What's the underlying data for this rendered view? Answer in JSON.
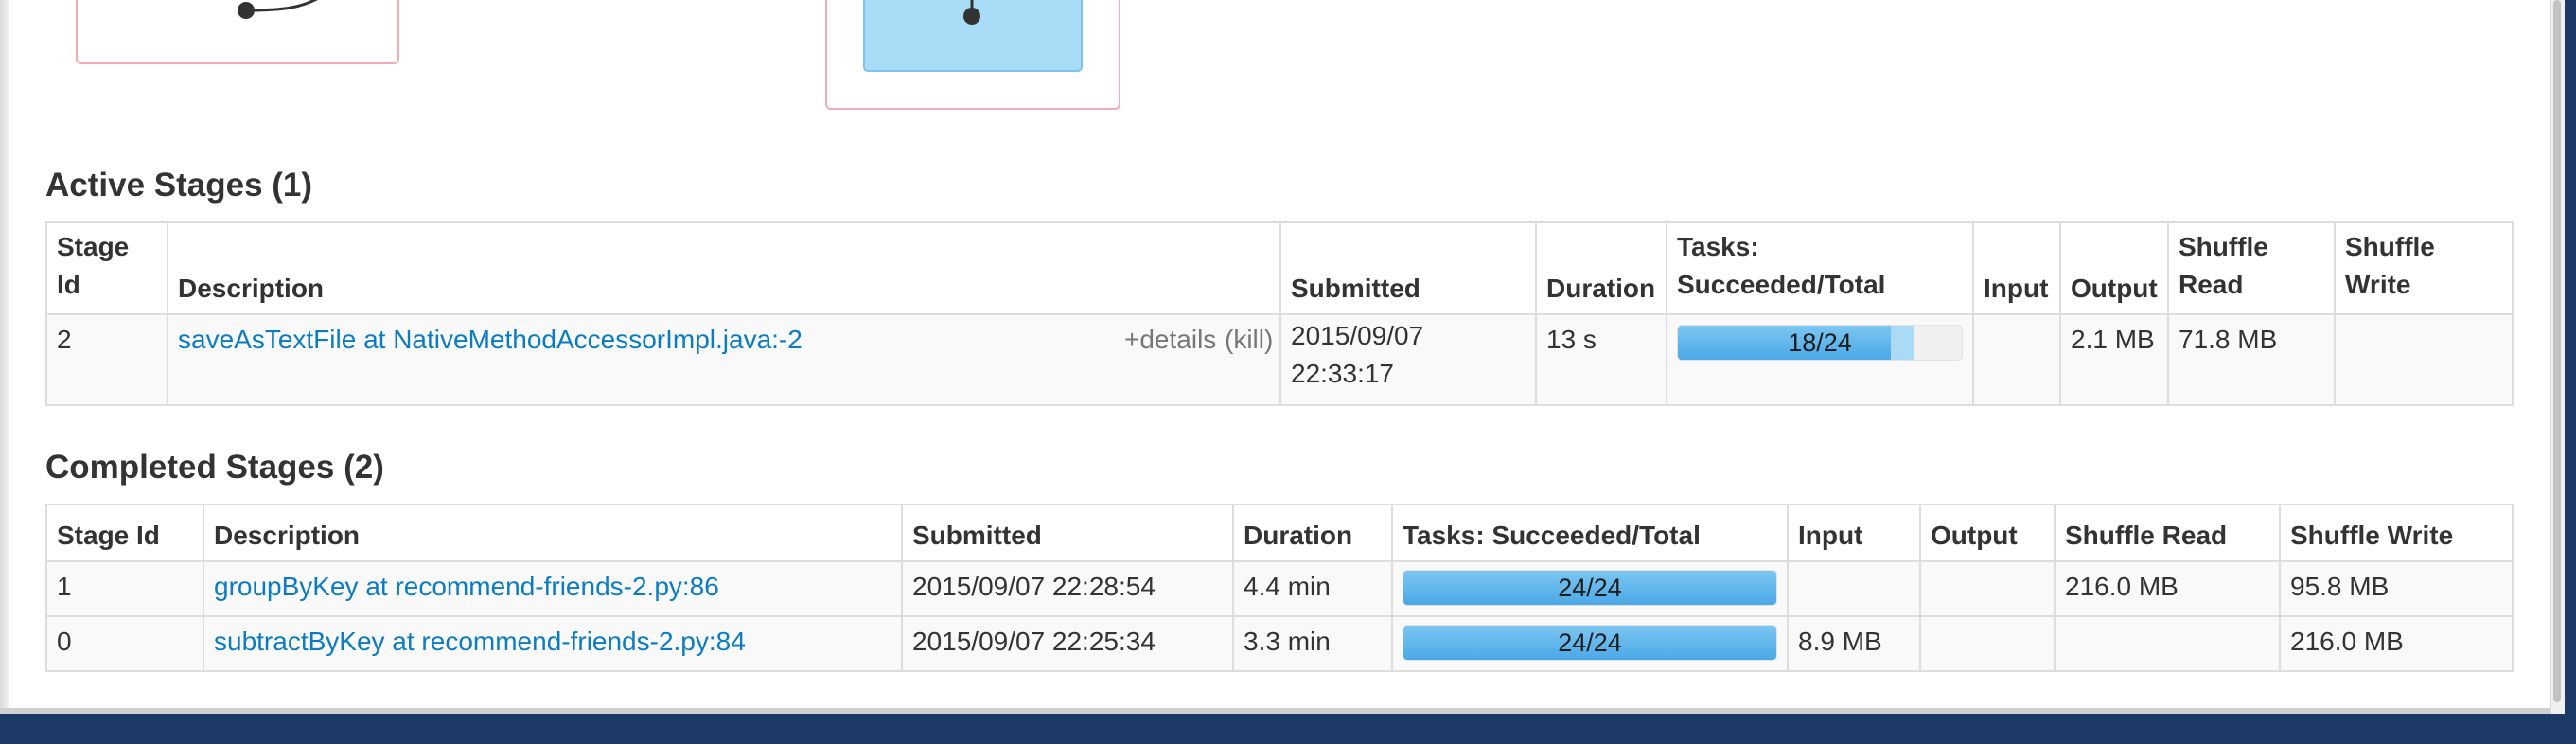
{
  "active_section": {
    "title": "Active Stages (1)",
    "columns": [
      "Stage Id",
      "Description",
      "Submitted",
      "Duration",
      "Tasks: Succeeded/Total",
      "Input",
      "Output",
      "Shuffle Read",
      "Shuffle Write"
    ],
    "rows": [
      {
        "stage_id": "2",
        "description": "saveAsTextFile at NativeMethodAccessorImpl.java:-2",
        "details_label": "+details",
        "kill_label": "(kill)",
        "submitted": "2015/09/07 22:33:17",
        "duration": "13 s",
        "tasks_label": "18/24",
        "tasks_completed_fraction": 0.75,
        "tasks_running_fraction": 0.083,
        "input": "",
        "output": "2.1 MB",
        "shuffle_read": "71.8 MB",
        "shuffle_write": ""
      }
    ]
  },
  "completed_section": {
    "title": "Completed Stages (2)",
    "columns": [
      "Stage Id",
      "Description",
      "Submitted",
      "Duration",
      "Tasks: Succeeded/Total",
      "Input",
      "Output",
      "Shuffle Read",
      "Shuffle Write"
    ],
    "rows": [
      {
        "stage_id": "1",
        "description": "groupByKey at recommend-friends-2.py:86",
        "submitted": "2015/09/07 22:28:54",
        "duration": "4.4 min",
        "tasks_label": "24/24",
        "tasks_completed_fraction": 1.0,
        "input": "",
        "output": "",
        "shuffle_read": "216.0 MB",
        "shuffle_write": "95.8 MB"
      },
      {
        "stage_id": "0",
        "description": "subtractByKey at recommend-friends-2.py:84",
        "submitted": "2015/09/07 22:25:34",
        "duration": "3.3 min",
        "tasks_label": "24/24",
        "tasks_completed_fraction": 1.0,
        "input": "8.9 MB",
        "output": "",
        "shuffle_read": "",
        "shuffle_write": "216.0 MB"
      }
    ]
  },
  "colors": {
    "link": "#0b7cc2",
    "progress_done": "#4ba8e6",
    "progress_running": "#a9dbf7",
    "dag_cluster_border": "#f2a9b8",
    "dag_node_fill": "#a8dcf7"
  }
}
